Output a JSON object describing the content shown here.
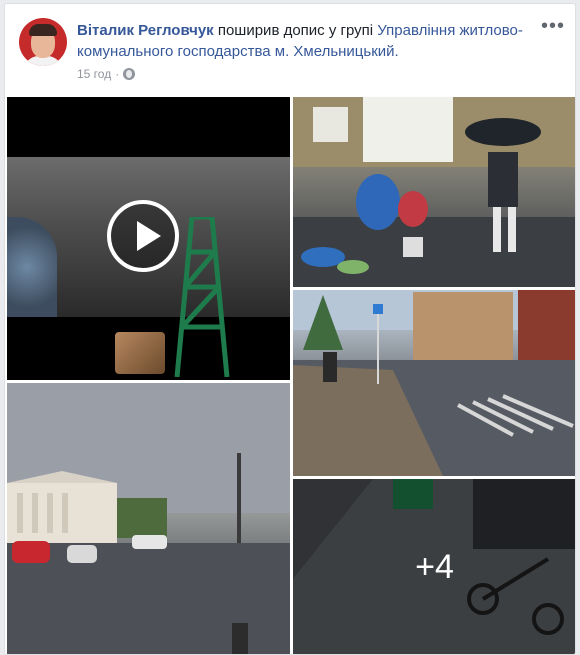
{
  "post": {
    "author": "Віталик Регловчук",
    "action_text": " поширив допис у групі ",
    "group": "Управління житлово-комунального господарства м. Хмельницький.",
    "time": "15 год",
    "more_label": "•••"
  },
  "gallery": {
    "more_count": "+4"
  },
  "icons": {
    "menu": "more-icon",
    "audience": "globe-icon",
    "video": "play-icon"
  },
  "colors": {
    "link": "#365899",
    "meta": "#90949c",
    "background": "#e9ebee"
  }
}
